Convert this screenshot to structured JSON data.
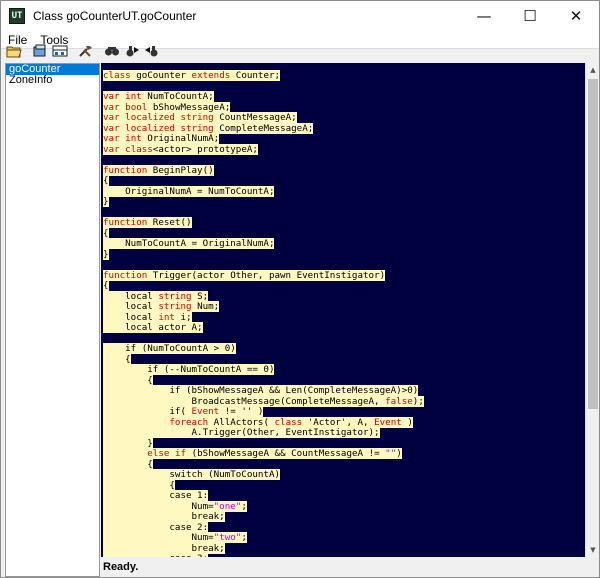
{
  "window": {
    "title": "Class goCounterUT.goCounter",
    "app_icon": "UT",
    "minimize": "—",
    "maximize": "☐",
    "close": "✕"
  },
  "menu": [
    "File",
    "Tools"
  ],
  "toolbar": {
    "icons": [
      "open-folder-icon",
      "compile-icon",
      "browse-classes-icon",
      "tools-icon",
      "find-icon",
      "find-next-icon",
      "find-prev-icon"
    ]
  },
  "sidebar": {
    "items": [
      {
        "label": "goCounter",
        "selected": true
      },
      {
        "label": "ZoneInfo",
        "selected": false
      }
    ]
  },
  "code": {
    "lines": [
      [
        [
          "kw",
          "class"
        ],
        [
          "t",
          " goCounter "
        ],
        [
          "kw",
          "extends"
        ],
        [
          "t",
          " Counter;"
        ]
      ],
      [],
      [
        [
          "kw",
          "var"
        ],
        [
          "t",
          " "
        ],
        [
          "kw",
          "int"
        ],
        [
          "t",
          " NumToCountA;"
        ]
      ],
      [
        [
          "kw",
          "var"
        ],
        [
          "t",
          " "
        ],
        [
          "kw",
          "bool"
        ],
        [
          "t",
          " bShowMessageA;"
        ]
      ],
      [
        [
          "kw",
          "var"
        ],
        [
          "t",
          " "
        ],
        [
          "kw",
          "localized"
        ],
        [
          "t",
          " "
        ],
        [
          "kw",
          "string"
        ],
        [
          "t",
          " CountMessageA;"
        ]
      ],
      [
        [
          "kw",
          "var"
        ],
        [
          "t",
          " "
        ],
        [
          "kw",
          "localized"
        ],
        [
          "t",
          " "
        ],
        [
          "kw",
          "string"
        ],
        [
          "t",
          " CompleteMessageA;"
        ]
      ],
      [
        [
          "kw",
          "var"
        ],
        [
          "t",
          " "
        ],
        [
          "kw",
          "int"
        ],
        [
          "t",
          " OriginalNumA;"
        ]
      ],
      [
        [
          "kw",
          "var"
        ],
        [
          "t",
          " "
        ],
        [
          "kw",
          "class"
        ],
        [
          "t",
          "<actor> prototypeA;"
        ]
      ],
      [],
      [
        [
          "kw",
          "function"
        ],
        [
          "t",
          " BeginPlay()"
        ]
      ],
      [
        [
          "t",
          "{"
        ]
      ],
      [
        [
          "t",
          "    OriginalNumA = NumToCountA;"
        ]
      ],
      [
        [
          "t",
          "}"
        ]
      ],
      [],
      [
        [
          "kw",
          "function"
        ],
        [
          "t",
          " Reset()"
        ]
      ],
      [
        [
          "t",
          "{"
        ]
      ],
      [
        [
          "t",
          "    NumToCountA = OriginalNumA;"
        ]
      ],
      [
        [
          "t",
          "}"
        ]
      ],
      [],
      [
        [
          "kw",
          "function"
        ],
        [
          "t",
          " Trigger(actor Other, pawn EventInstigator)"
        ]
      ],
      [
        [
          "t",
          "{"
        ]
      ],
      [
        [
          "t",
          "    local "
        ],
        [
          "kw",
          "string"
        ],
        [
          "t",
          " S;"
        ]
      ],
      [
        [
          "t",
          "    local "
        ],
        [
          "kw",
          "string"
        ],
        [
          "t",
          " Num;"
        ]
      ],
      [
        [
          "t",
          "    local "
        ],
        [
          "kw",
          "int"
        ],
        [
          "t",
          " i;"
        ]
      ],
      [
        [
          "t",
          "    local actor A;"
        ]
      ],
      [],
      [
        [
          "t",
          "    if (NumToCountA > 0)"
        ]
      ],
      [
        [
          "t",
          "    {"
        ]
      ],
      [
        [
          "t",
          "        if (--NumToCountA == 0)"
        ]
      ],
      [
        [
          "t",
          "        {"
        ]
      ],
      [
        [
          "t",
          "            if (bShowMessageA && Len(CompleteMessageA)>0)"
        ]
      ],
      [
        [
          "t",
          "                BroadcastMessage(CompleteMessageA, "
        ],
        [
          "kw",
          "false"
        ],
        [
          "t",
          ");"
        ]
      ],
      [
        [
          "t",
          "            if( "
        ],
        [
          "kw",
          "Event"
        ],
        [
          "t",
          " != '' )"
        ]
      ],
      [
        [
          "t",
          "            "
        ],
        [
          "kw",
          "foreach"
        ],
        [
          "t",
          " AllActors( "
        ],
        [
          "kw",
          "class"
        ],
        [
          "t",
          " 'Actor', A, "
        ],
        [
          "kw",
          "Event"
        ],
        [
          "t",
          " )"
        ]
      ],
      [
        [
          "t",
          "                A.Trigger(Other, EventInstigator);"
        ]
      ],
      [
        [
          "t",
          "        }"
        ]
      ],
      [
        [
          "t",
          "        "
        ],
        [
          "kw",
          "else"
        ],
        [
          "t",
          " "
        ],
        [
          "kw",
          "if"
        ],
        [
          "t",
          " (bShowMessageA && CountMessageA != "
        ],
        [
          "str",
          "\"\""
        ],
        [
          "t",
          ")"
        ]
      ],
      [
        [
          "t",
          "        {"
        ]
      ],
      [
        [
          "t",
          "            switch (NumToCountA)"
        ]
      ],
      [
        [
          "t",
          "            {"
        ]
      ],
      [
        [
          "t",
          "            case 1:"
        ]
      ],
      [
        [
          "t",
          "                Num="
        ],
        [
          "str",
          "\"one\""
        ],
        [
          "t",
          ";"
        ]
      ],
      [
        [
          "t",
          "                break;"
        ]
      ],
      [
        [
          "t",
          "            case 2:"
        ]
      ],
      [
        [
          "t",
          "                Num="
        ],
        [
          "str",
          "\"two\""
        ],
        [
          "t",
          ";"
        ]
      ],
      [
        [
          "t",
          "                break;"
        ]
      ],
      [
        [
          "t",
          "            case 3:"
        ]
      ]
    ]
  },
  "status": "Ready."
}
